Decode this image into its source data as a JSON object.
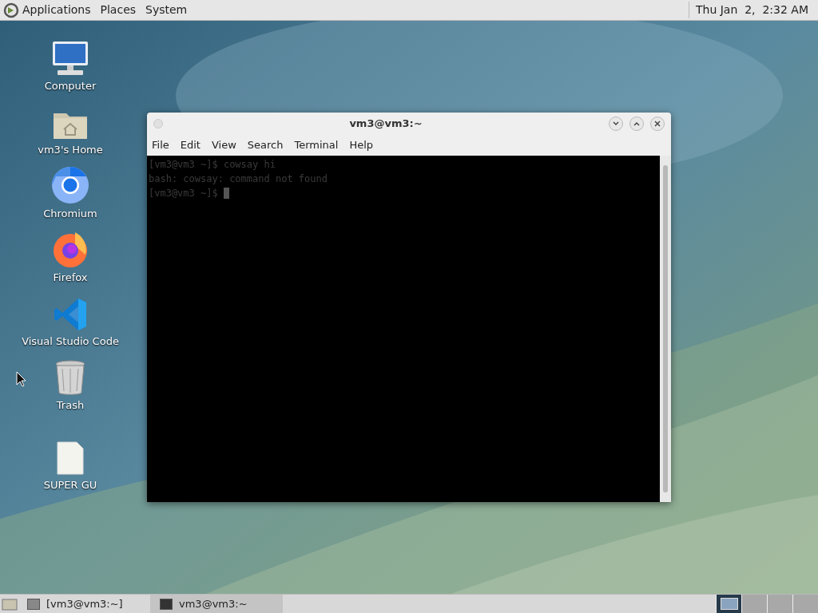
{
  "top_panel": {
    "menus": [
      "Applications",
      "Places",
      "System"
    ],
    "clock": "Thu Jan  2,  2:32 AM"
  },
  "desktop_icons": [
    {
      "label": "Computer",
      "kind": "computer"
    },
    {
      "label": "vm3's Home",
      "kind": "home"
    },
    {
      "label": "Chromium",
      "kind": "chromium"
    },
    {
      "label": "Firefox",
      "kind": "firefox"
    },
    {
      "label": "Visual Studio Code",
      "kind": "vscode"
    },
    {
      "label": "Trash",
      "kind": "trash"
    },
    {
      "label": "SUPER GU",
      "kind": "file"
    }
  ],
  "window": {
    "title": "vm3@vm3:~",
    "menu": [
      "File",
      "Edit",
      "View",
      "Search",
      "Terminal",
      "Help"
    ],
    "lines": [
      "[vm3@vm3 ~]$ cowsay hi",
      "bash: cowsay: command not found",
      "[vm3@vm3 ~]$ "
    ]
  },
  "taskbar": {
    "items": [
      {
        "label": "[vm3@vm3:~]",
        "selected": false
      },
      {
        "label": "vm3@vm3:~",
        "selected": true
      }
    ],
    "workspaces": [
      {
        "selected": true
      },
      {
        "selected": false
      },
      {
        "selected": false
      },
      {
        "selected": false
      }
    ]
  }
}
